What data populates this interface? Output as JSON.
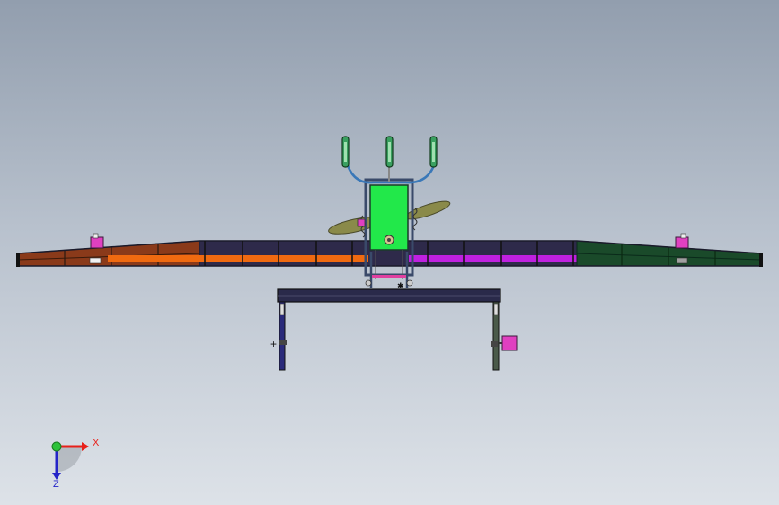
{
  "triad": {
    "x_label": "X",
    "z_label": "Z",
    "x_color": "#e8201a",
    "y_color": "#2dc23a",
    "z_color": "#2424c8"
  },
  "model": {
    "frame_color": "#2a3a5a",
    "left_wing_color": "#8a3a1a",
    "left_inner_strip_color": "#f06a10",
    "right_inner_strip_color": "#c020e0",
    "right_wing_color": "#1a4a2a",
    "cab_color": "#22e84a",
    "cab_frame_color": "#3a4a6a",
    "blade_color": "#8a8a4a",
    "leg_left_color": "#2a2a7a",
    "leg_right_color": "#4a5a4a",
    "bracket_color": "#e040c0",
    "handle_color": "#3aa060"
  }
}
